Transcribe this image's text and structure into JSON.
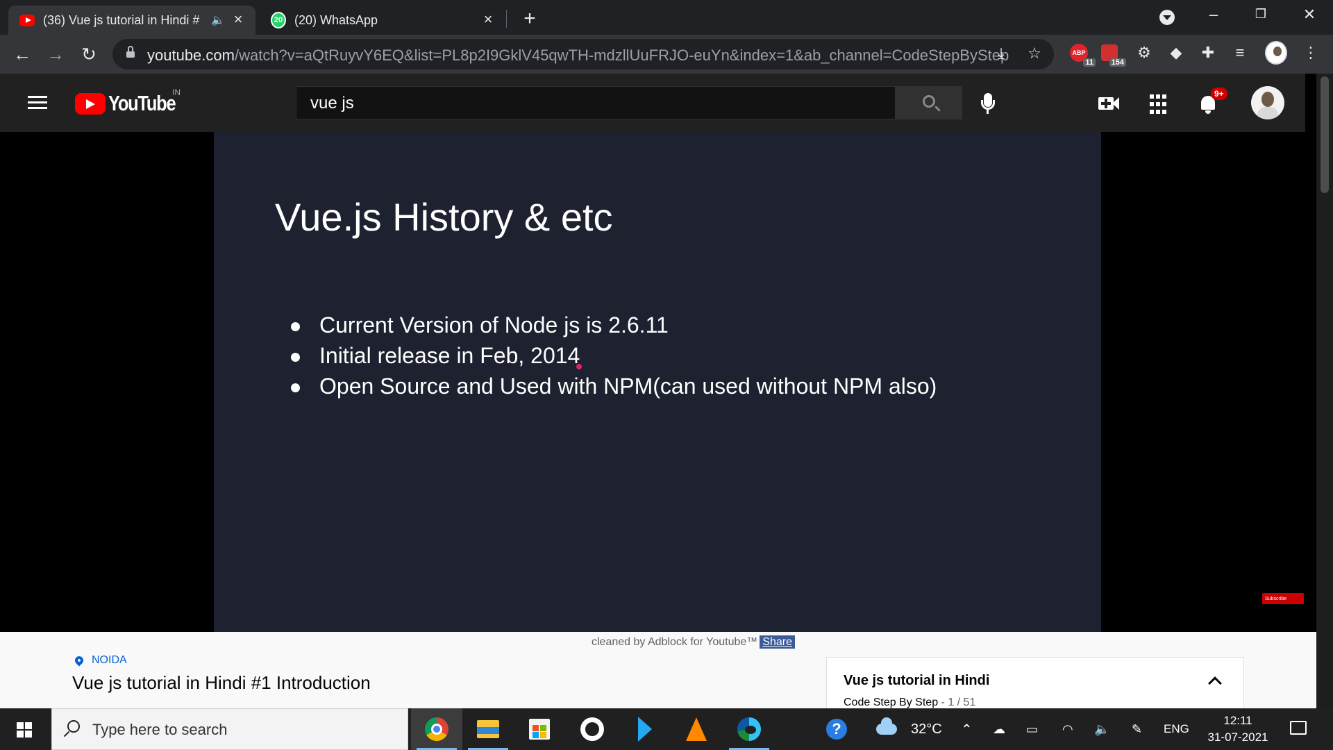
{
  "browser": {
    "tabs": [
      {
        "title": "(36) Vue js tutorial in Hindi #",
        "active": true,
        "favicon": "youtube-icon",
        "audio": true
      },
      {
        "title": "(20) WhatsApp",
        "active": false,
        "favicon": "whatsapp-icon",
        "badge": "20"
      }
    ],
    "new_tab": "+",
    "url_host": "youtube.com",
    "url_rest": "/watch?v=aQtRuyvY6EQ&list=PL8p2I9GklV45qwTH-mdzllUuFRJO-euYn&index=1&ab_channel=CodeStepByStep",
    "extensions": [
      {
        "name": "adblock-plus",
        "label": "ABP",
        "badge": "11"
      },
      {
        "name": "red-extension",
        "badge": "154"
      }
    ]
  },
  "youtube": {
    "logo_text": "YouTube",
    "country_code": "IN",
    "search_query": "vue js",
    "notification_count": "9+"
  },
  "video": {
    "slide_title": "Vue.js History & etc",
    "bullets": [
      "Current Version of Node js is 2.6.11",
      "Initial release in Feb, 2014",
      "Open Source and Used with NPM(can used without NPM also)"
    ],
    "watermark": "Subscribe"
  },
  "below_video": {
    "adblock_text": "cleaned by Adblock for Youtube™",
    "share_label": "Share",
    "location": "NOIDA",
    "title": "Vue js tutorial in Hindi #1 Introduction",
    "playlist_title": "Vue js tutorial in Hindi",
    "playlist_channel": "Code Step By Step",
    "playlist_position": "- 1 / 51"
  },
  "taskbar": {
    "search_placeholder": "Type here to search",
    "temperature": "32°C",
    "language": "ENG",
    "time": "12:11",
    "date": "31-07-2021"
  },
  "colors": {
    "youtube_red": "#ff0000",
    "slide_bg": "#1d2130",
    "link_blue": "#065fd4"
  }
}
